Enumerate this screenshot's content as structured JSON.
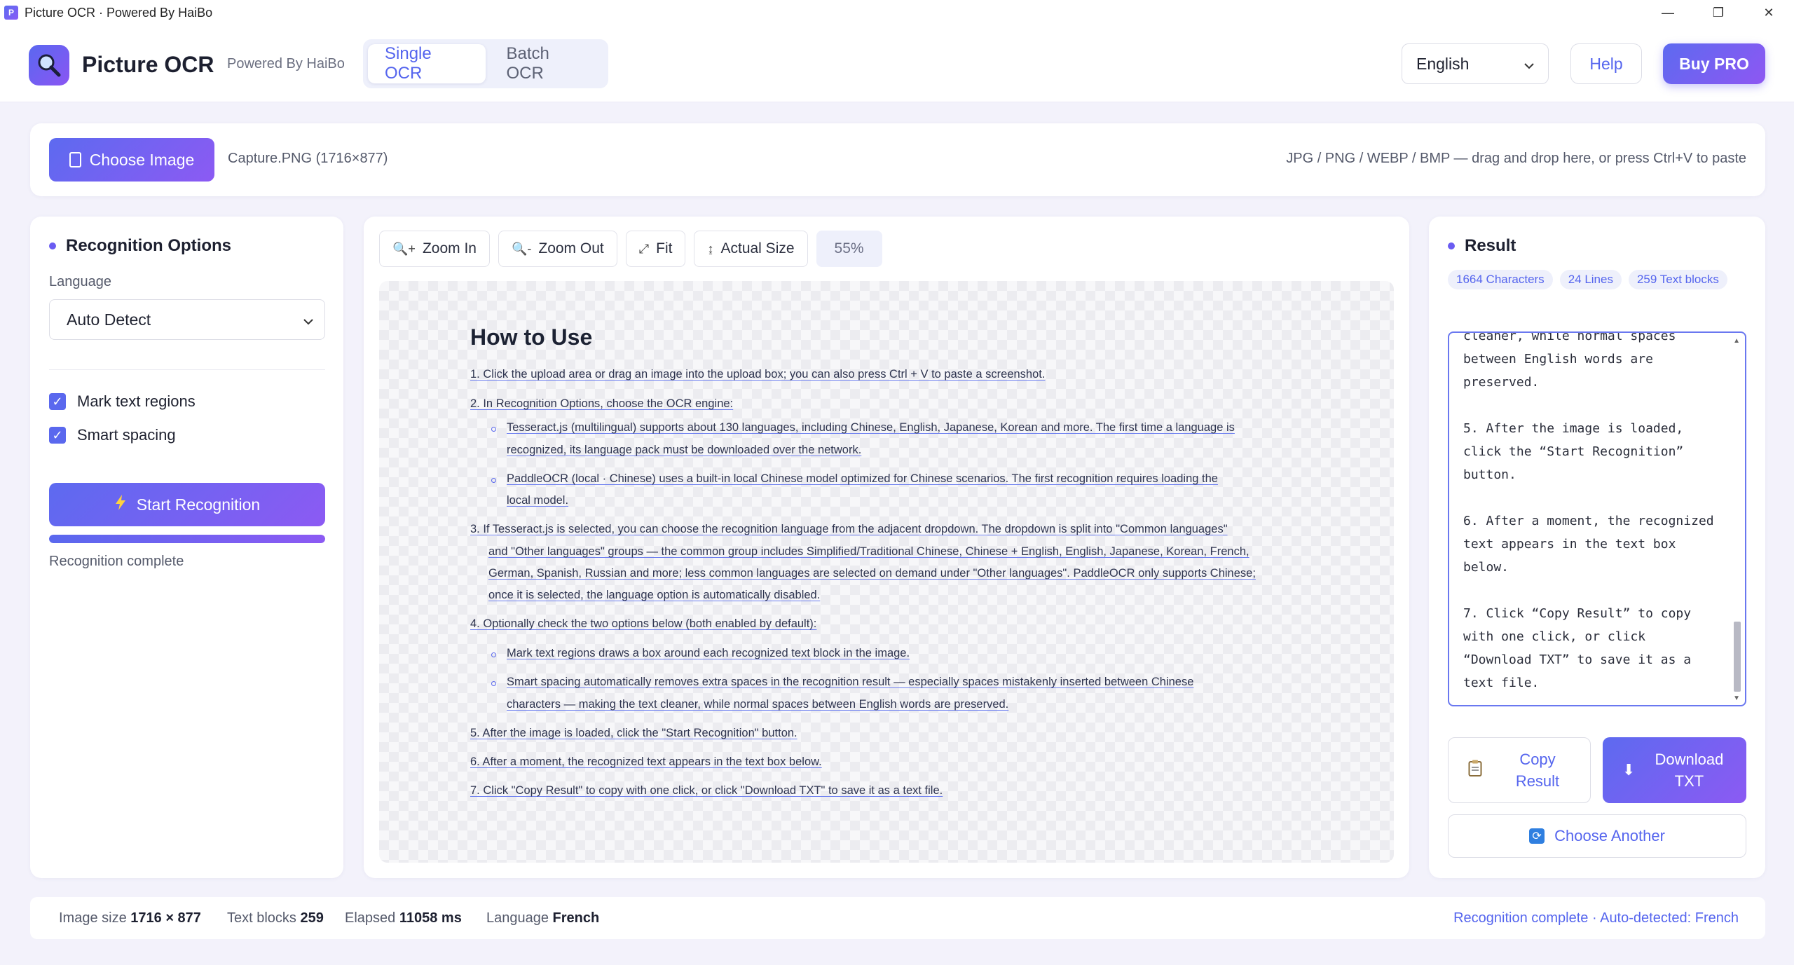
{
  "window": {
    "title": "Picture OCR · Powered By HaiBo",
    "minimize": "—",
    "maximize": "❐",
    "close": "✕"
  },
  "header": {
    "brand": "Picture OCR",
    "powered": "Powered By HaiBo",
    "tabs": [
      {
        "label": "Single OCR",
        "active": true
      },
      {
        "label": "Batch OCR",
        "active": false
      }
    ],
    "language": "English",
    "help": "Help",
    "buy": "Buy PRO"
  },
  "upload": {
    "choose_label": "Choose Image",
    "file_name": "Capture.PNG (1716×877)",
    "hint": "JPG / PNG / WEBP / BMP — drag and drop here, or press Ctrl+V to paste"
  },
  "options": {
    "title": "Recognition Options",
    "language_label": "Language",
    "language_value": "Auto Detect",
    "mark_regions": "Mark text regions",
    "smart_spacing": "Smart spacing",
    "start": "Start Recognition",
    "progress": 1.0,
    "status": "Recognition complete"
  },
  "preview": {
    "zoom_in": "Zoom In",
    "zoom_out": "Zoom Out",
    "fit": "Fit",
    "actual": "Actual Size",
    "zoom_level": "55%",
    "doc": {
      "heading": "How to Use",
      "l1": "1. Click the upload area or drag an image into the upload box; you can also press Ctrl + V to paste a screenshot.",
      "l2": "2. In Recognition Options, choose the OCR engine:",
      "l3a": "Tesseract.js (multilingual) supports about 130 languages, including Chinese, English, Japanese, Korean and more. The first time a language is",
      "l3b": "recognized, its language pack must be downloaded over the network.",
      "l4a": "PaddleOCR (local · Chinese) uses a built-in local Chinese model optimized for Chinese scenarios. The first recognition requires loading the",
      "l4b": "local model.",
      "l5a": "3. If Tesseract.js is selected, you can choose the recognition language from the adjacent dropdown. The dropdown is split into \"Common languages\"",
      "l5b": "and \"Other languages\" groups — the common group includes Simplified/Traditional Chinese, Chinese + English, English, Japanese, Korean, French,",
      "l5c": "German, Spanish, Russian and more; less common languages are selected on demand under \"Other languages\". PaddleOCR only supports Chinese;",
      "l5d": "once it is selected, the language option is automatically disabled.",
      "l6": "4. Optionally check the two options below (both enabled by default):",
      "l7": "Mark text regions draws a box around each recognized text block in the image.",
      "l8a": "Smart spacing automatically removes extra spaces in the recognition result — especially spaces mistakenly inserted between Chinese",
      "l8b": "characters — making the text cleaner, while normal spaces between English words are preserved.",
      "l9": "5. After the image is loaded, click the \"Start Recognition\" button.",
      "l10": "6. After a moment, the recognized text appears in the text box below.",
      "l11": "7. Click \"Copy Result\" to copy with one click, or click \"Download TXT\" to save it as a text file."
    }
  },
  "result": {
    "title": "Result",
    "chips": {
      "chars": "1664 Characters",
      "lines": "24 Lines",
      "blocks": "259 Text blocks"
    },
    "text": "cleaner, while normal spaces\nbetween English words are\npreserved.\n\n5. After the image is loaded,\nclick the “Start Recognition”\nbutton.\n\n6. After a moment, the recognized\ntext appears in the text box\nbelow.\n\n7. Click “Copy Result” to copy\nwith one click, or click\n“Download TXT” to save it as a\ntext file.",
    "copy": "Copy Result",
    "download": "Download TXT",
    "another": "Choose Another"
  },
  "footer": {
    "image_size_label": "Image size",
    "image_size": "1716 × 877",
    "blocks_label": "Text blocks",
    "blocks": "259",
    "elapsed_label": "Elapsed",
    "elapsed": "11058 ms",
    "language_label": "Language",
    "language": "French",
    "right": "Recognition complete · Auto-detected: French"
  },
  "colors": {
    "accent": "#5565ee",
    "accent2": "#8c5af3",
    "background": "#f3f2fb"
  }
}
